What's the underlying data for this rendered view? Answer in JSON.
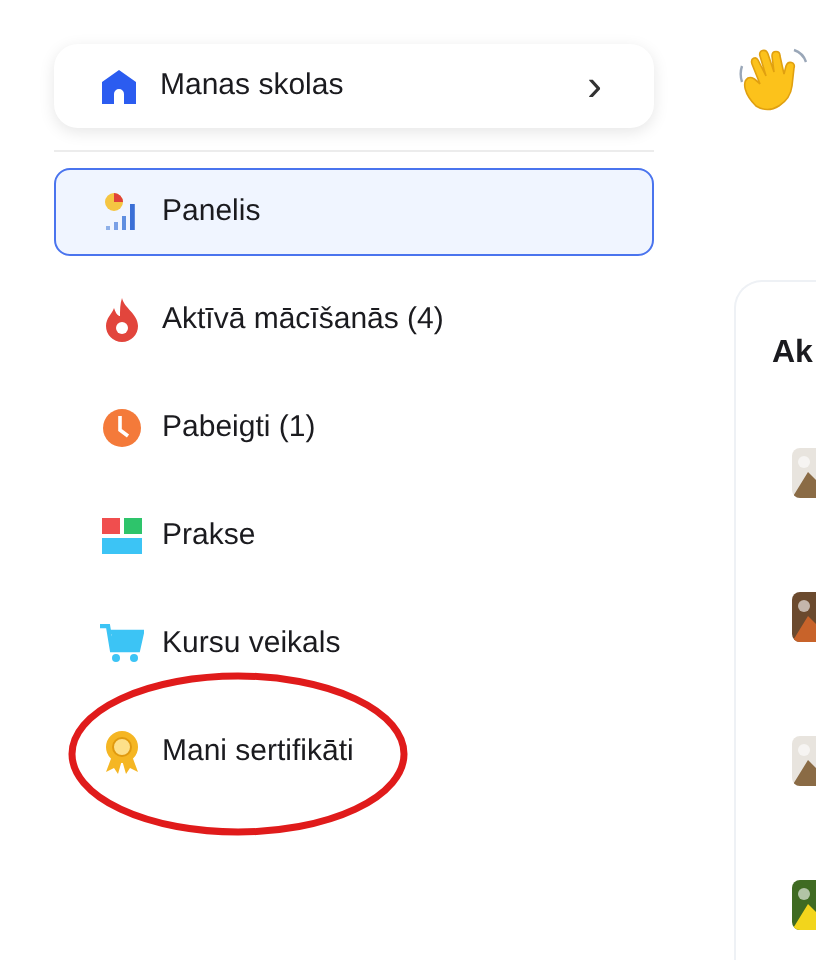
{
  "school_switch": {
    "label": "Manas skolas",
    "chevron": "›",
    "expanded": false
  },
  "nav": [
    {
      "kind": "dashboard",
      "label": "Panelis",
      "selected": true,
      "circled": false
    },
    {
      "kind": "fire",
      "label": "Aktīvā mācīšanās (4)",
      "selected": false,
      "circled": false
    },
    {
      "kind": "clock",
      "label": "Pabeigti (1)",
      "selected": false,
      "circled": false
    },
    {
      "kind": "blocks",
      "label": "Prakse",
      "selected": false,
      "circled": false
    },
    {
      "kind": "cart",
      "label": "Kursu veikals",
      "selected": false,
      "circled": false
    },
    {
      "kind": "award",
      "label": "Mani sertifikāti",
      "selected": false,
      "circled": true
    }
  ],
  "main": {
    "card_title": "Ak"
  }
}
